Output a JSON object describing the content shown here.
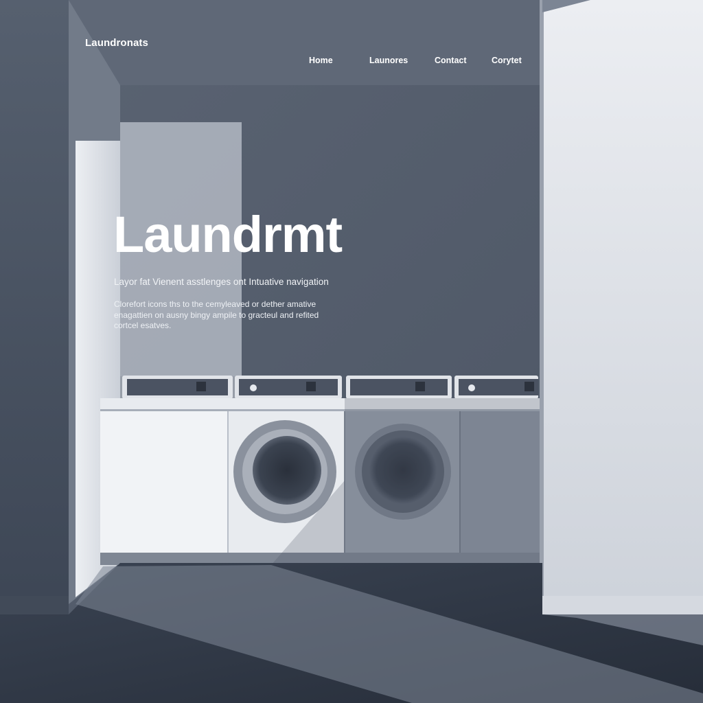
{
  "header": {
    "brand": "Laundronats",
    "nav": [
      {
        "label": "Home"
      },
      {
        "label": "Launores"
      },
      {
        "label": "Contact"
      },
      {
        "label": "Corytet"
      }
    ]
  },
  "hero": {
    "title": "Laundrmt",
    "subtitle": "Layor fat Vienent asstlenges ont Intuative navigation",
    "body_lines": [
      "Clorefort icons ths to the cemyleaved or dether amative",
      "enagattien on ausny bingy ampile to gracteul and refited",
      "cortcel esatves."
    ]
  },
  "colors": {
    "wall_dark": "#4c5565",
    "wall_light": "#dde1e8",
    "machine": "#c9ced6",
    "floor": "#323b4a",
    "text": "#ffffff"
  }
}
